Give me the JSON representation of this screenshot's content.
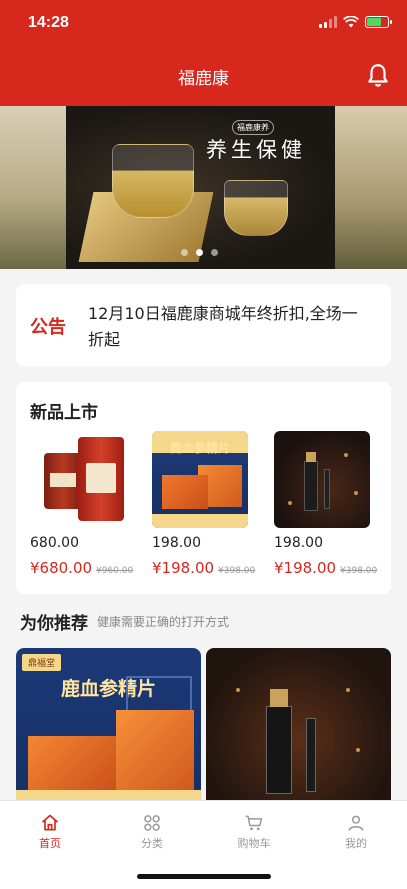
{
  "status_bar": {
    "time": "14:28"
  },
  "header": {
    "title": "福鹿康"
  },
  "banner": {
    "tag": "福鹿康养",
    "slogan": "养生保健",
    "slide_count": 3,
    "active_slide": 1
  },
  "notice": {
    "tag": "公告",
    "text": "12月10日福鹿康商城年终折扣,全场一折起"
  },
  "new_products": {
    "title": "新品上市",
    "items": [
      {
        "price": "680.00",
        "sale_price": "¥680.00",
        "original_price": "¥960.00",
        "image": "red-tea-tins"
      },
      {
        "price": "198.00",
        "sale_price": "¥198.00",
        "original_price": "¥398.00",
        "image": "deer-blood-ginseng-box",
        "image_text": "鹿血参精片"
      },
      {
        "price": "198.00",
        "sale_price": "¥198.00",
        "original_price": "¥398.00",
        "image": "dark-bottle-product"
      }
    ]
  },
  "recommend": {
    "title": "为你推荐",
    "subtitle": "健康需要正确的打开方式",
    "items": [
      {
        "brand": "鼎福堂",
        "headline": "鹿血参精片"
      },
      {
        "headline": ""
      }
    ]
  },
  "tabbar": {
    "items": [
      {
        "label": "首页",
        "icon": "home-icon",
        "active": true
      },
      {
        "label": "分类",
        "icon": "grid-icon",
        "active": false
      },
      {
        "label": "购物车",
        "icon": "cart-icon",
        "active": false
      },
      {
        "label": "我的",
        "icon": "user-icon",
        "active": false
      }
    ]
  },
  "colors": {
    "primary": "#d6281d",
    "background": "#f4f4f4",
    "muted": "#999999"
  }
}
